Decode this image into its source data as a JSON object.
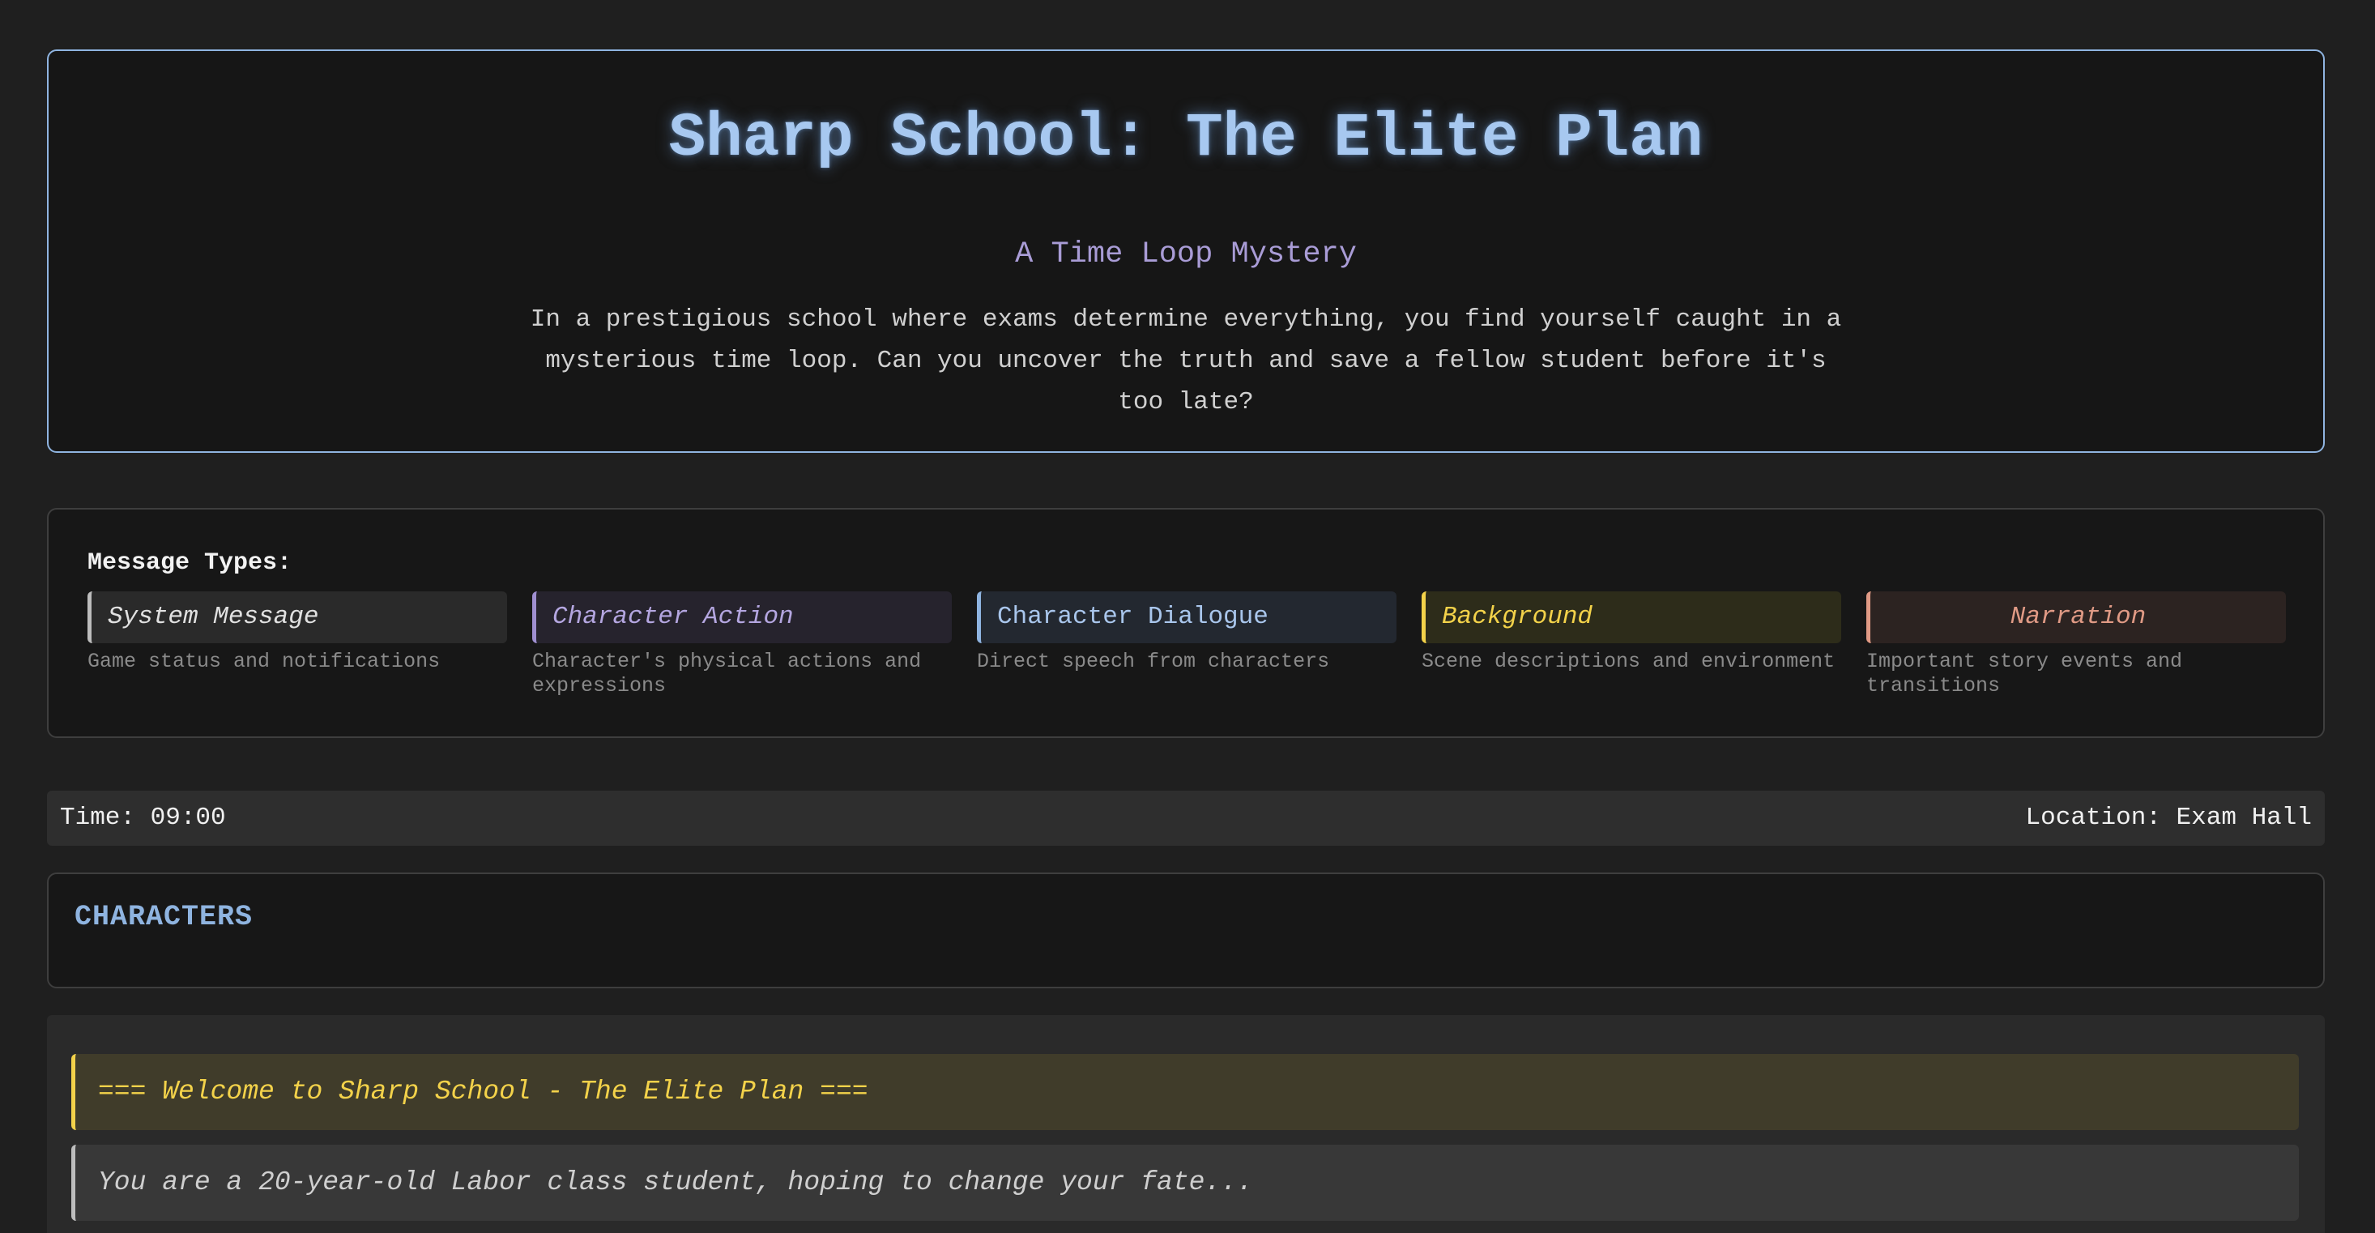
{
  "header": {
    "title": "Sharp School: The Elite Plan",
    "subtitle": "A Time Loop Mystery",
    "description": "In a prestigious school where exams determine everything, you find yourself caught in a mysterious time loop. Can you uncover the truth and save a fellow student before it's too late?"
  },
  "legend": {
    "heading": "Message Types:",
    "items": [
      {
        "label": "System Message",
        "description": "Game status and notifications",
        "color": "#bdbdbd"
      },
      {
        "label": "Character Action",
        "description": "Character's physical actions and expressions",
        "color": "#9f8fd0"
      },
      {
        "label": "Character Dialogue",
        "description": "Direct speech from characters",
        "color": "#8fb4e0"
      },
      {
        "label": "Background",
        "description": "Scene descriptions and environment",
        "color": "#f3d24a"
      },
      {
        "label": "Narration",
        "description": "Important story events and transitions",
        "color": "#e09a85"
      }
    ]
  },
  "status": {
    "time": "Time: 09:00",
    "location": "Location: Exam Hall"
  },
  "characters": {
    "heading": "CHARACTERS"
  },
  "log": {
    "messages": [
      {
        "type": "background",
        "text": "=== Welcome to Sharp School - The Elite Plan ==="
      },
      {
        "type": "system",
        "text": "You are a 20-year-old Labor class student, hoping to change your fate..."
      }
    ]
  }
}
